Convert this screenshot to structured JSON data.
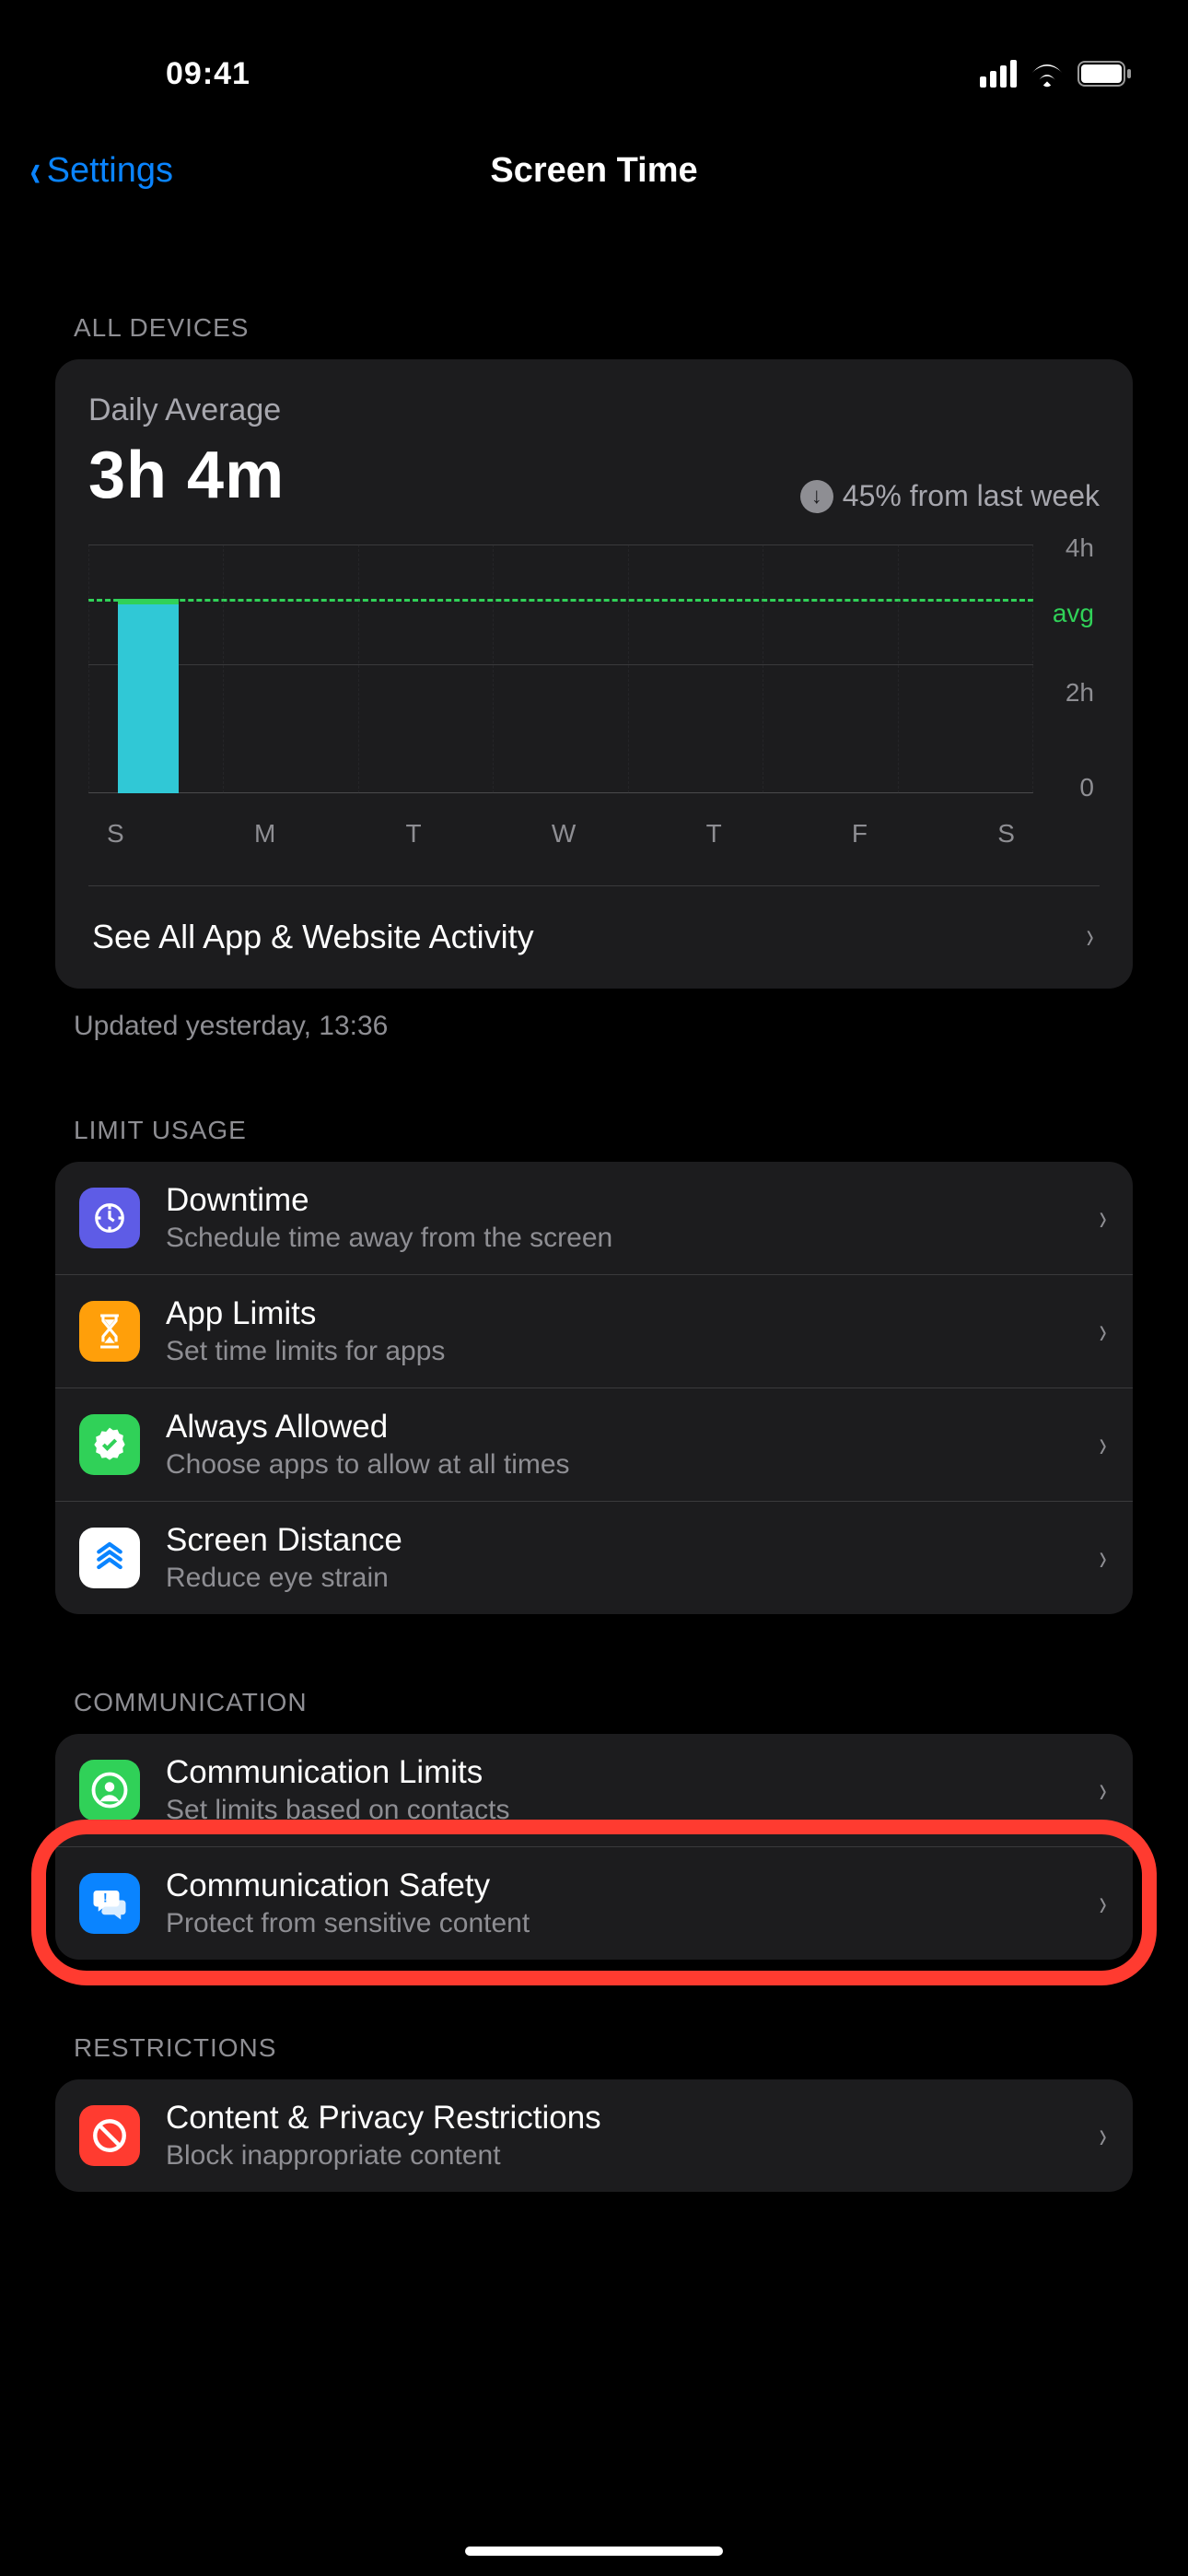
{
  "status": {
    "time": "09:41"
  },
  "nav": {
    "back": "Settings",
    "title": "Screen Time"
  },
  "sections": {
    "all_devices_header": "All Devices",
    "limit_usage_header": "Limit Usage",
    "communication_header": "Communication",
    "restrictions_header": "Restrictions"
  },
  "daily_average": {
    "label": "Daily Average",
    "value": "3h 4m",
    "delta": "45% from last week",
    "see_all": "See All App & Website Activity",
    "updated": "Updated yesterday, 13:36"
  },
  "limit_usage": [
    {
      "title": "Downtime",
      "subtitle": "Schedule time away from the screen"
    },
    {
      "title": "App Limits",
      "subtitle": "Set time limits for apps"
    },
    {
      "title": "Always Allowed",
      "subtitle": "Choose apps to allow at all times"
    },
    {
      "title": "Screen Distance",
      "subtitle": "Reduce eye strain"
    }
  ],
  "communication": [
    {
      "title": "Communication Limits",
      "subtitle": "Set limits based on contacts"
    },
    {
      "title": "Communication Safety",
      "subtitle": "Protect from sensitive content"
    }
  ],
  "restrictions": [
    {
      "title": "Content & Privacy Restrictions",
      "subtitle": "Block inappropriate content"
    }
  ],
  "chart_data": {
    "type": "bar",
    "categories": [
      "S",
      "M",
      "T",
      "W",
      "T",
      "F",
      "S"
    ],
    "values_hours": [
      3.07,
      0,
      0,
      0,
      0,
      0,
      0
    ],
    "ylabel": "hours",
    "ylim": [
      0,
      4
    ],
    "yticks": [
      "0",
      "2h",
      "4h"
    ],
    "avg_line_h": 3.07,
    "avg_label": "avg",
    "title": "Daily Average",
    "delta_percent": -45
  }
}
